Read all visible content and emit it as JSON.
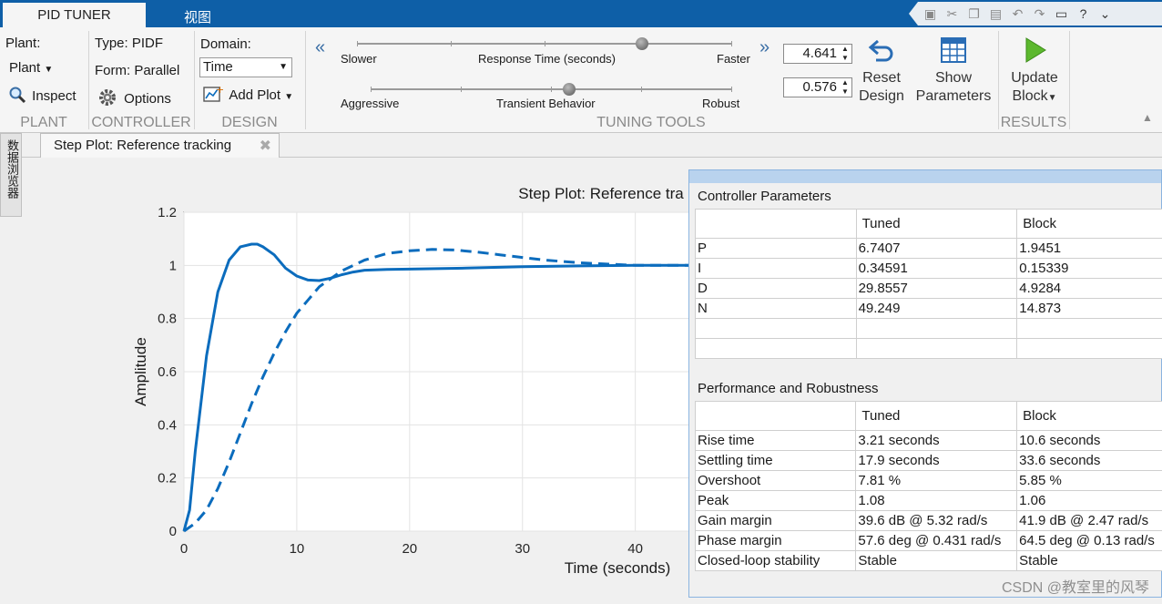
{
  "tabs": {
    "pid_tuner": "PID TUNER",
    "view": "视图"
  },
  "plant": {
    "label": "Plant:",
    "dropdown": "Plant",
    "inspect": "Inspect",
    "section": "PLANT"
  },
  "controller": {
    "type": "Type: PIDF",
    "form": "Form: Parallel",
    "options": "Options",
    "section": "CONTROLLER"
  },
  "design": {
    "domain_label": "Domain:",
    "domain_value": "Time",
    "add_plot": "Add Plot",
    "section": "DESIGN"
  },
  "tuning": {
    "slower": "Slower",
    "response_time": "Response Time (seconds)",
    "faster": "Faster",
    "aggressive": "Aggressive",
    "transient": "Transient Behavior",
    "robust": "Robust",
    "response_value": "4.641",
    "transient_value": "0.576",
    "response_slider_pos": 0.76,
    "transient_slider_pos": 0.55,
    "reset_line1": "Reset",
    "reset_line2": "Design",
    "show_line1": "Show",
    "show_line2": "Parameters",
    "section": "TUNING TOOLS"
  },
  "results": {
    "update_line1": "Update",
    "update_line2": "Block",
    "section": "RESULTS"
  },
  "side_panel_label": "数据浏览器",
  "doc_tab": "Step Plot: Reference tracking",
  "chart_data": {
    "type": "line",
    "title": "Step Plot: Reference tra",
    "xlabel": "Time (seconds)",
    "ylabel": "Amplitude",
    "xlim": [
      0,
      46
    ],
    "ylim": [
      0,
      1.2
    ],
    "xticks": [
      "0",
      "10",
      "20",
      "30",
      "40"
    ],
    "yticks": [
      "0",
      "0.2",
      "0.4",
      "0.6",
      "0.8",
      "1",
      "1.2"
    ],
    "grid": true,
    "series": [
      {
        "style": "solid",
        "color": "#0b6cbd",
        "x": [
          0,
          0.5,
          1,
          2,
          3,
          4,
          5,
          6,
          6.5,
          7,
          8,
          9,
          10,
          11,
          12,
          13,
          14,
          15,
          16,
          18,
          20,
          25,
          30,
          35,
          40,
          46
        ],
        "y": [
          0,
          0.08,
          0.3,
          0.66,
          0.9,
          1.02,
          1.07,
          1.08,
          1.08,
          1.07,
          1.04,
          0.99,
          0.96,
          0.945,
          0.943,
          0.952,
          0.965,
          0.975,
          0.982,
          0.985,
          0.986,
          0.99,
          0.995,
          0.998,
          1.0,
          1.0
        ]
      },
      {
        "style": "dashed",
        "color": "#0b6cbd",
        "x": [
          0,
          1,
          2,
          3,
          4,
          5,
          6,
          7,
          8,
          9,
          10,
          11,
          12,
          14,
          16,
          18,
          20,
          22,
          24,
          26,
          28,
          30,
          32,
          35,
          40,
          46
        ],
        "y": [
          0,
          0.03,
          0.08,
          0.16,
          0.26,
          0.37,
          0.48,
          0.58,
          0.67,
          0.75,
          0.82,
          0.87,
          0.92,
          0.98,
          1.02,
          1.045,
          1.055,
          1.06,
          1.058,
          1.05,
          1.04,
          1.03,
          1.02,
          1.01,
          1.0,
          1.0
        ]
      }
    ]
  },
  "params": {
    "title": "Controller Parameters",
    "headers": [
      "",
      "Tuned",
      "Block"
    ],
    "rows": [
      [
        "P",
        "6.7407",
        "1.9451"
      ],
      [
        "I",
        "0.34591",
        "0.15339"
      ],
      [
        "D",
        "29.8557",
        "4.9284"
      ],
      [
        "N",
        "49.249",
        "14.873"
      ],
      [
        "",
        "",
        ""
      ],
      [
        "",
        "",
        ""
      ]
    ]
  },
  "perf": {
    "title": "Performance and Robustness",
    "headers": [
      "",
      "Tuned",
      "Block"
    ],
    "rows": [
      [
        "Rise time",
        "3.21 seconds",
        "10.6 seconds"
      ],
      [
        "Settling time",
        "17.9 seconds",
        "33.6 seconds"
      ],
      [
        "Overshoot",
        "7.81 %",
        "5.85 %"
      ],
      [
        "Peak",
        "1.08",
        "1.06"
      ],
      [
        "Gain margin",
        "39.6 dB @ 5.32 rad/s",
        "41.9 dB @ 2.47 rad/s"
      ],
      [
        "Phase margin",
        "57.6 deg @ 0.431 rad/s",
        "64.5 deg @ 0.13 rad/s"
      ],
      [
        "Closed-loop stability",
        "Stable",
        "Stable"
      ]
    ]
  },
  "watermark": "CSDN @教室里的风琴"
}
